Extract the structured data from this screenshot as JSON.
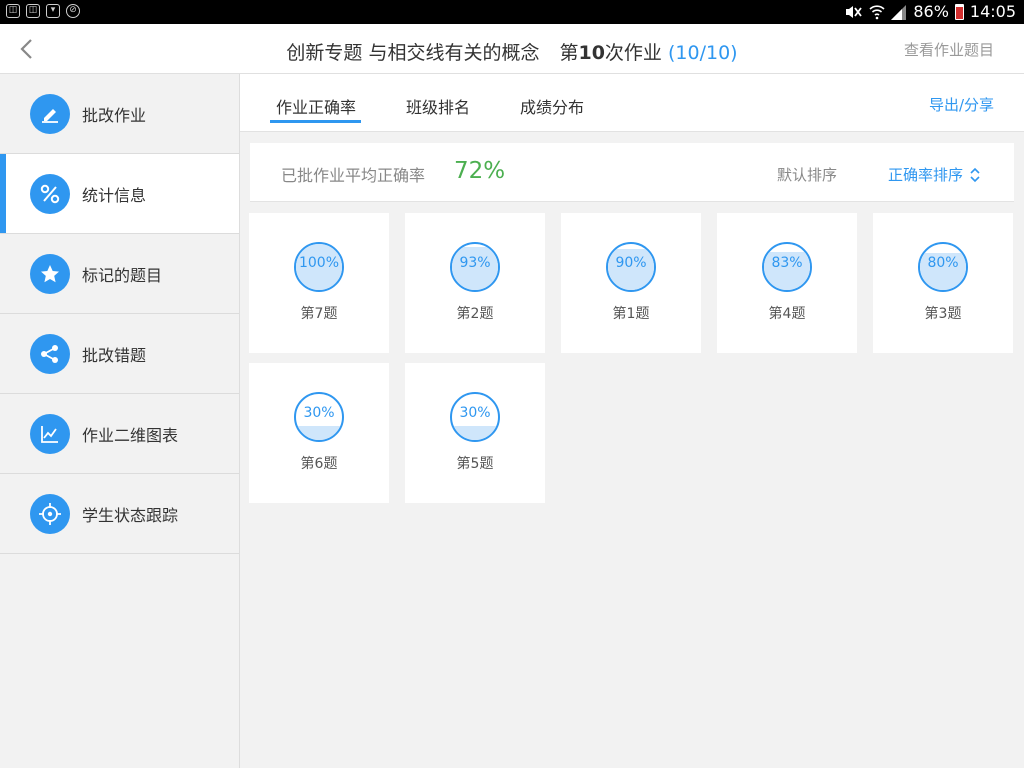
{
  "status_bar": {
    "battery": "86%",
    "time": "14:05"
  },
  "header": {
    "title_topic": "创新专题 与相交线有关的概念",
    "title_prefix": "第",
    "title_num": "10",
    "title_suffix": "次作业",
    "title_count": "(10/10)",
    "view_questions": "查看作业题目"
  },
  "sidebar": {
    "items": [
      {
        "label": "批改作业",
        "icon": "pen-icon"
      },
      {
        "label": "统计信息",
        "icon": "percent-icon"
      },
      {
        "label": "标记的题目",
        "icon": "star-icon"
      },
      {
        "label": "批改错题",
        "icon": "share-icon"
      },
      {
        "label": "作业二维图表",
        "icon": "chart-icon"
      },
      {
        "label": "学生状态跟踪",
        "icon": "target-icon"
      }
    ]
  },
  "tabs": [
    "作业正确率",
    "班级排名",
    "成绩分布"
  ],
  "export_label": "导出/分享",
  "summary": {
    "label": "已批作业平均正确率",
    "value": "72%",
    "sort_default": "默认排序",
    "sort_rate": "正确率排序"
  },
  "questions": [
    {
      "label": "第7题",
      "percent": "100%",
      "fill": 1.0
    },
    {
      "label": "第2题",
      "percent": "93%",
      "fill": 0.93
    },
    {
      "label": "第1题",
      "percent": "90%",
      "fill": 0.9
    },
    {
      "label": "第4题",
      "percent": "83%",
      "fill": 0.83
    },
    {
      "label": "第3题",
      "percent": "80%",
      "fill": 0.8
    },
    {
      "label": "第6题",
      "percent": "30%",
      "fill": 0.3
    },
    {
      "label": "第5题",
      "percent": "30%",
      "fill": 0.3
    }
  ],
  "colors": {
    "accent": "#2f97f0",
    "success": "#4caf50",
    "fill": "#cfe6fb"
  }
}
